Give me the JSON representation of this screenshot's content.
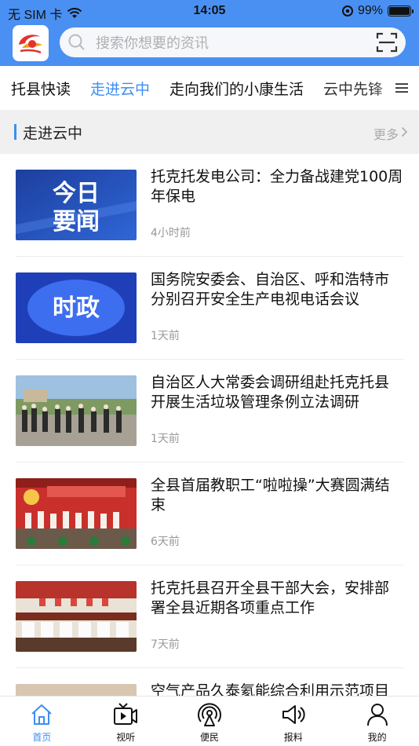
{
  "status_bar": {
    "carrier": "无 SIM 卡",
    "time": "14:05",
    "battery": "99%",
    "battery_level": 0.99
  },
  "header": {
    "logo_icon": "app-logo-icon",
    "search": {
      "placeholder": "搜索你想要的资讯"
    },
    "scan_icon": "scan-icon",
    "accent_color": "#4a90f2"
  },
  "tabs": [
    {
      "label": "托县快读",
      "active": false
    },
    {
      "label": "走进云中",
      "active": true
    },
    {
      "label": "走向我们的小康生活",
      "active": false
    },
    {
      "label": "云中先锋",
      "active": false
    }
  ],
  "section": {
    "title": "走进云中",
    "more": "更多"
  },
  "news": [
    {
      "title": "托克托发电公司：全力备战建党100周年保电",
      "time": "4小时前",
      "thumb_text": "今日要闻"
    },
    {
      "title": "国务院安委会、自治区、呼和浩特市分别召开安全生产电视电话会议",
      "time": "1天前",
      "thumb_text": "时政"
    },
    {
      "title": "自治区人大常委会调研组赴托克托县开展生活垃圾管理条例立法调研",
      "time": "1天前"
    },
    {
      "title": "全县首届教职工“啦啦操”大赛圆满结束",
      "time": "6天前"
    },
    {
      "title": "托克托县召开全县干部大会，安排部署全县近期各项重点工作",
      "time": "7天前"
    },
    {
      "title": "空气产品久泰氦能综合利用示范项目",
      "time": ""
    }
  ],
  "bottom_nav": [
    {
      "label": "首页",
      "icon": "home-icon",
      "active": true
    },
    {
      "label": "视听",
      "icon": "tv-icon",
      "active": false
    },
    {
      "label": "便民",
      "icon": "broadcast-icon",
      "active": false
    },
    {
      "label": "报料",
      "icon": "megaphone-icon",
      "active": false
    },
    {
      "label": "我的",
      "icon": "user-icon",
      "active": false
    }
  ]
}
